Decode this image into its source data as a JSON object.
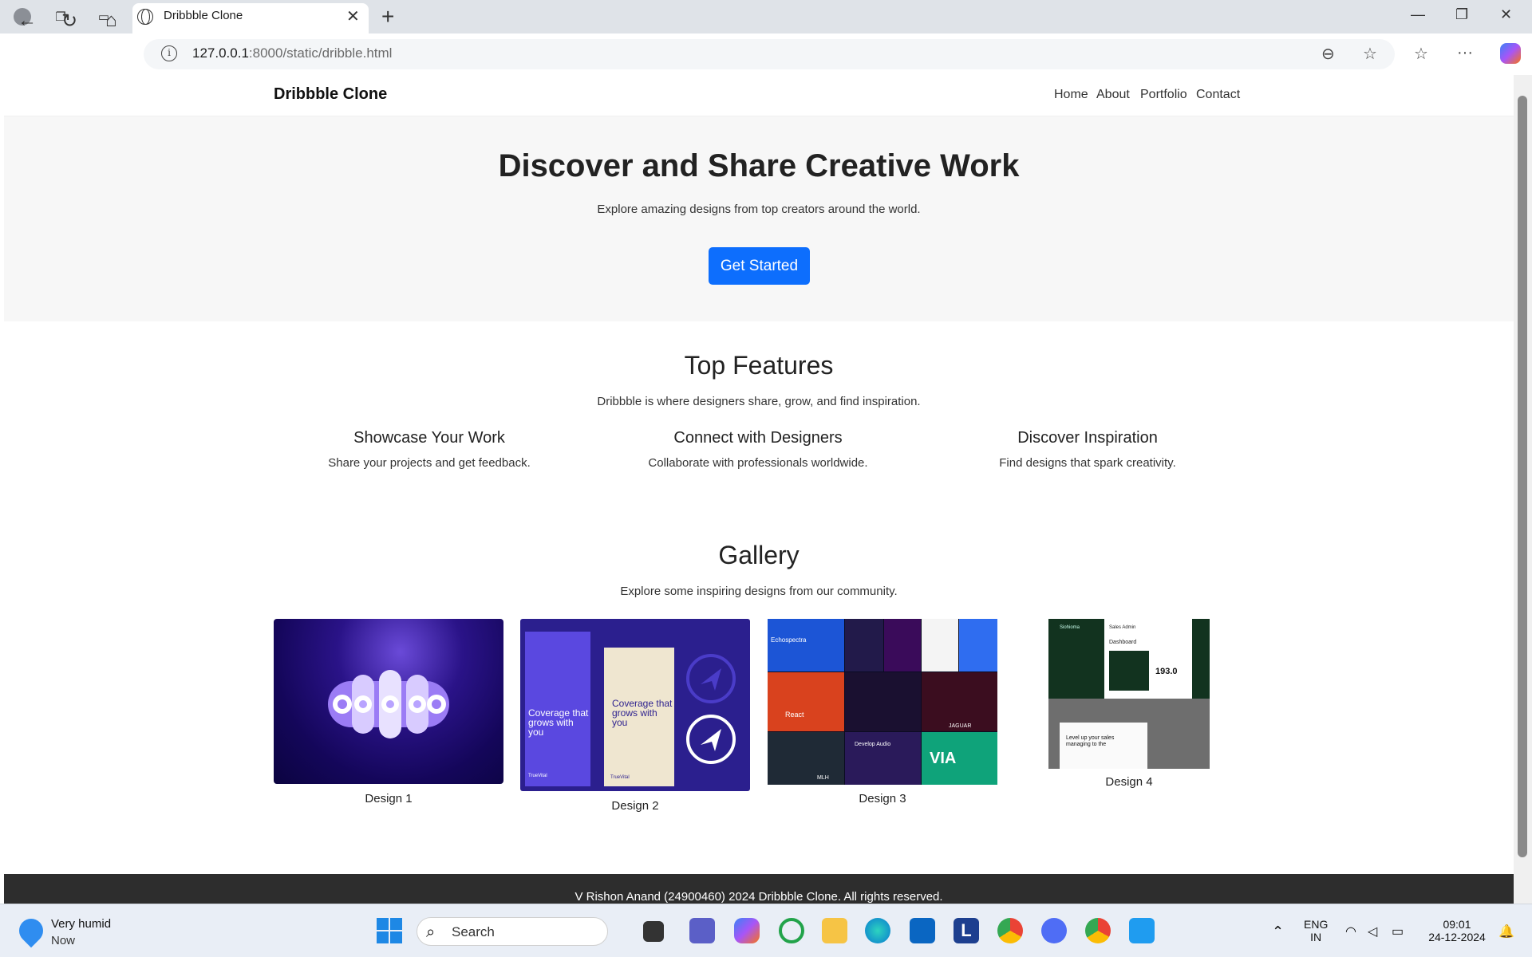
{
  "browser": {
    "tab_title": "Dribbble Clone",
    "url_host": "127.0.0.1",
    "url_path": ":8000/static/dribble.html"
  },
  "site": {
    "brand": "Dribbble Clone",
    "nav": [
      "Home",
      "About",
      "Portfolio",
      "Contact"
    ],
    "hero": {
      "title": "Discover and Share Creative Work",
      "subtitle": "Explore amazing designs from top creators around the world.",
      "cta": "Get Started"
    },
    "features": {
      "title": "Top Features",
      "subtitle": "Dribbble is where designers share, grow, and find inspiration.",
      "items": [
        {
          "title": "Showcase Your Work",
          "desc": "Share your projects and get feedback."
        },
        {
          "title": "Connect with Designers",
          "desc": "Collaborate with professionals worldwide."
        },
        {
          "title": "Discover Inspiration",
          "desc": "Find designs that spark creativity."
        }
      ]
    },
    "gallery": {
      "title": "Gallery",
      "subtitle": "Explore some inspiring designs from our community.",
      "items": [
        {
          "caption": "Design 1",
          "art": "code"
        },
        {
          "caption": "Design 2",
          "art_text": "Coverage that grows with you",
          "brand_mark": "TrueVital"
        },
        {
          "caption": "Design 3",
          "tile_labels": [
            "Echospectra",
            "React",
            "JAGUAR",
            "Develop Audio",
            "VIA",
            "MLH"
          ]
        },
        {
          "caption": "Design 4",
          "dashboard": {
            "app": "Siohioma",
            "header": "Sales Admin",
            "title": "Dashboard",
            "value": "193.0",
            "tagline": "Level up your sales managing to the"
          }
        }
      ]
    },
    "footer": "V Rishon Anand (24900460) 2024 Dribbble Clone. All rights reserved."
  },
  "taskbar": {
    "weather_main": "Very humid",
    "weather_sub": "Now",
    "search": "Search",
    "lang1": "ENG",
    "lang2": "IN",
    "time": "09:01",
    "date": "24-12-2024"
  }
}
